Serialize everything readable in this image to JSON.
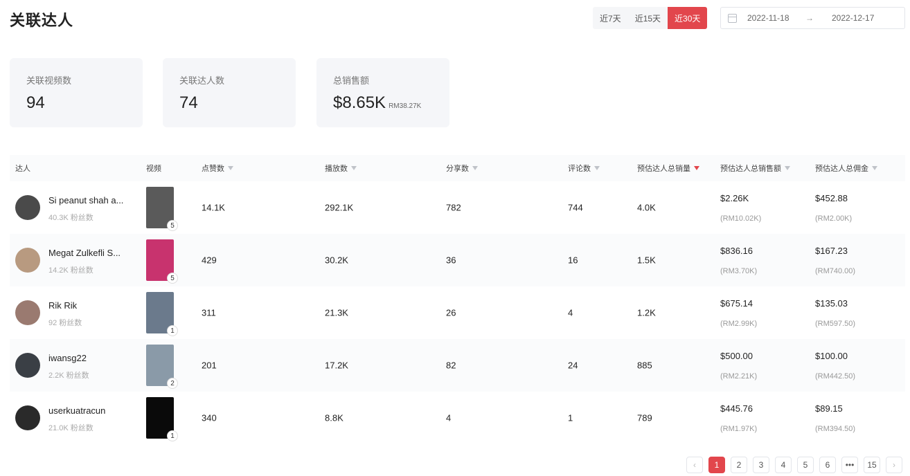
{
  "header": {
    "title": "关联达人",
    "ranges": [
      "近7天",
      "近15天",
      "近30天"
    ],
    "active_range_index": 2,
    "date_start": "2022-11-18",
    "date_arrow": "→",
    "date_end": "2022-12-17"
  },
  "stats": [
    {
      "label": "关联视频数",
      "value": "94",
      "sub": ""
    },
    {
      "label": "关联达人数",
      "value": "74",
      "sub": ""
    },
    {
      "label": "总销售额",
      "value": "$8.65K",
      "sub": "RM38.27K"
    }
  ],
  "table": {
    "columns": [
      "达人",
      "视频",
      "点赞数",
      "播放数",
      "分享数",
      "评论数",
      "预估达人总销量",
      "预估达人总销售额",
      "预估达人总佣金"
    ],
    "rows": [
      {
        "name": "Si peanut shah a...",
        "fans": "40.3K 粉丝数",
        "video_count": "5",
        "likes": "14.1K",
        "plays": "292.1K",
        "shares": "782",
        "comments": "744",
        "sales": "4.0K",
        "revenue": "$2.26K",
        "revenue_rm": "(RM10.02K)",
        "commission": "$452.88",
        "commission_rm": "(RM2.00K)",
        "avatar_color": "#4a4a4a",
        "thumb_color": "#5a5a5a"
      },
      {
        "name": "Megat Zulkefli S...",
        "fans": "14.2K 粉丝数",
        "video_count": "5",
        "likes": "429",
        "plays": "30.2K",
        "shares": "36",
        "comments": "16",
        "sales": "1.5K",
        "revenue": "$836.16",
        "revenue_rm": "(RM3.70K)",
        "commission": "$167.23",
        "commission_rm": "(RM740.00)",
        "avatar_color": "#b89a80",
        "thumb_color": "#c8336e"
      },
      {
        "name": "Rik Rik",
        "fans": "92 粉丝数",
        "video_count": "1",
        "likes": "311",
        "plays": "21.3K",
        "shares": "26",
        "comments": "4",
        "sales": "1.2K",
        "revenue": "$675.14",
        "revenue_rm": "(RM2.99K)",
        "commission": "$135.03",
        "commission_rm": "(RM597.50)",
        "avatar_color": "#9a7a70",
        "thumb_color": "#6b7a8c"
      },
      {
        "name": "iwansg22",
        "fans": "2.2K 粉丝数",
        "video_count": "2",
        "likes": "201",
        "plays": "17.2K",
        "shares": "82",
        "comments": "24",
        "sales": "885",
        "revenue": "$500.00",
        "revenue_rm": "(RM2.21K)",
        "commission": "$100.00",
        "commission_rm": "(RM442.50)",
        "avatar_color": "#3a3f45",
        "thumb_color": "#8a9aa8"
      },
      {
        "name": "userkuatracun",
        "fans": "21.0K 粉丝数",
        "video_count": "1",
        "likes": "340",
        "plays": "8.8K",
        "shares": "4",
        "comments": "1",
        "sales": "789",
        "revenue": "$445.76",
        "revenue_rm": "(RM1.97K)",
        "commission": "$89.15",
        "commission_rm": "(RM394.50)",
        "avatar_color": "#2a2a2a",
        "thumb_color": "#0a0a0a"
      }
    ]
  },
  "pagination": {
    "prev": "‹",
    "pages": [
      "1",
      "2",
      "3",
      "4",
      "5",
      "6",
      "•••",
      "15"
    ],
    "active": "1",
    "next": "›"
  },
  "colors": {
    "accent": "#e2464c"
  }
}
